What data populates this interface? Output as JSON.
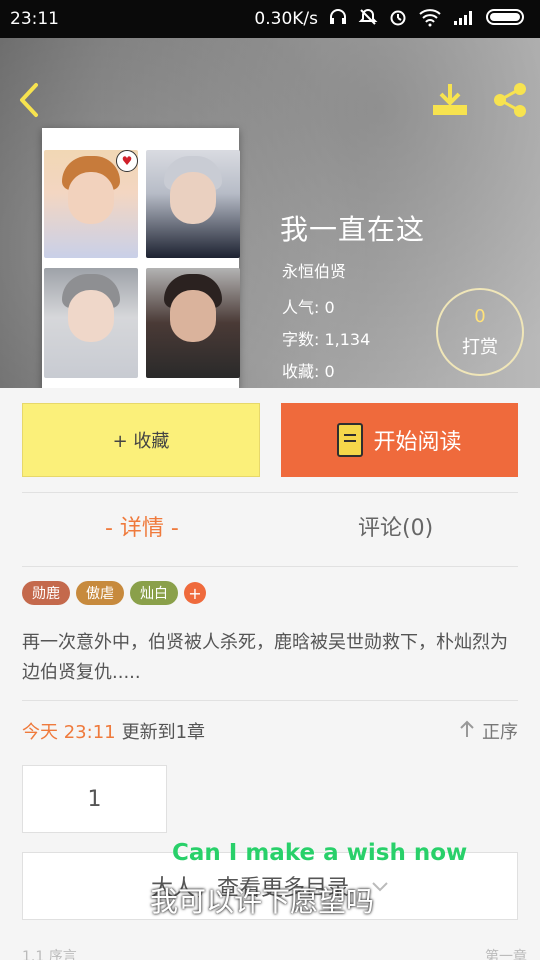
{
  "status_bar": {
    "time": "23:11",
    "net_speed": "0.30K/s",
    "icons": [
      "headphones-icon",
      "mute-icon",
      "alarm-icon",
      "wifi-icon",
      "signal-icon",
      "battery-icon"
    ]
  },
  "header": {
    "back_icon": "chevron-left-icon",
    "download_icon": "download-icon",
    "share_icon": "share-icon"
  },
  "book": {
    "title": "我一直在这",
    "author": "永恒伯贤",
    "popularity": "人气: 0",
    "word_count": "字数: 1,134",
    "favorites": "收藏: 0",
    "tip_count": "0",
    "tip_label": "打赏"
  },
  "actions": {
    "collect_label": "+ 收藏",
    "read_label": "开始阅读"
  },
  "tabs": {
    "detail": "- 详情 -",
    "comments": "评论(0)"
  },
  "tags": [
    {
      "label": "勋鹿",
      "color": "#c4694c"
    },
    {
      "label": "傲虐",
      "color": "#c78a3d"
    },
    {
      "label": "灿白",
      "color": "#8aa04a"
    }
  ],
  "description": "再一次意外中，伯贤被人杀死，鹿晗被吴世勋救下，朴灿烈为边伯贤复仇.....",
  "update_info": {
    "today": "今天 23:11",
    "text": "更新到1章",
    "sort": "正序"
  },
  "pagination": {
    "page": "1",
    "select_label": "大人，查看更多目录"
  },
  "overlay": {
    "english": "Can I make a wish now",
    "chinese": "我可以许下愿望吗"
  },
  "bottom": {
    "left": "1.1 序言",
    "right": "第一章"
  }
}
